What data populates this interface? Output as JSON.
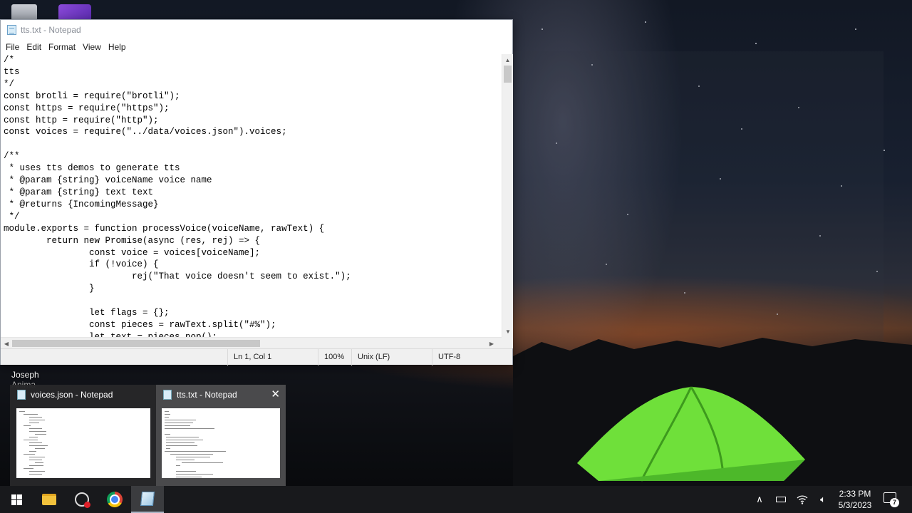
{
  "desktop": {
    "shortcut_label": "Joseph",
    "shortcut_sublabel": "Anima"
  },
  "notepad": {
    "title": "tts.txt - Notepad",
    "menu": [
      "File",
      "Edit",
      "Format",
      "View",
      "Help"
    ],
    "code_lines": [
      "/*",
      "tts",
      "*/",
      "const brotli = require(\"brotli\");",
      "const https = require(\"https\");",
      "const http = require(\"http\");",
      "const voices = require(\"../data/voices.json\").voices;",
      "",
      "/**",
      " * uses tts demos to generate tts",
      " * @param {string} voiceName voice name",
      " * @param {string} text text",
      " * @returns {IncomingMessage}",
      " */",
      "module.exports = function processVoice(voiceName, rawText) {",
      "        return new Promise(async (res, rej) => {",
      "                const voice = voices[voiceName];",
      "                if (!voice) {",
      "                        rej(\"That voice doesn't seem to exist.\");",
      "                }",
      "",
      "                let flags = {};",
      "                const pieces = rawText.split(\"#%\");",
      "                let text = pieces.pop();"
    ],
    "status": {
      "position": "Ln 1, Col 1",
      "zoom": "100%",
      "line_ending": "Unix (LF)",
      "encoding": "UTF-8"
    }
  },
  "taskbar_preview": {
    "items": [
      {
        "title": "voices.json - Notepad"
      },
      {
        "title": "tts.txt - Notepad"
      }
    ]
  },
  "taskbar": {
    "time": "2:33 PM",
    "date": "5/3/2023",
    "notification_count": "7"
  }
}
